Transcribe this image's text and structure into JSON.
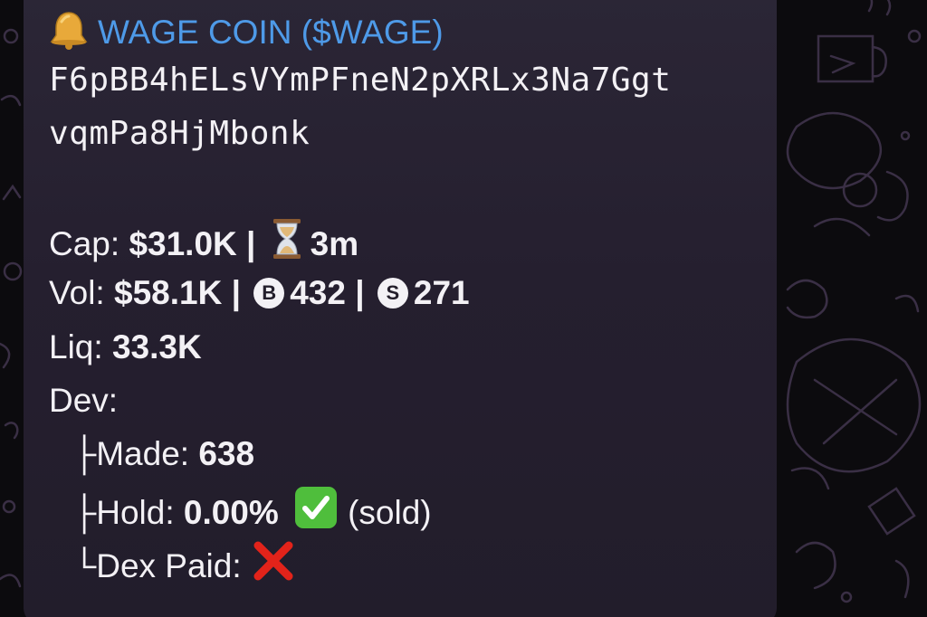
{
  "background": {
    "color": "#0c0b0e",
    "doodle_color": "#3a2f45",
    "bubble_color": "#2b2636"
  },
  "message": {
    "bell_icon": "bell-icon",
    "title": "WAGE COIN ($WAGE)",
    "title_color": "#4e9ae8",
    "address_line1": "F6pBB4hELsVYmPFneN2pXRLx3Na7Ggt",
    "address_line2": "vqmPa8HjMbonk",
    "cap_label": "Cap: ",
    "cap_value": "$31.0K |",
    "hourglass_icon": "hourglass-icon",
    "age_value": "3m",
    "vol_label": "Vol: ",
    "vol_value": "$58.1K |",
    "buy_badge": "B",
    "buys": "432 |",
    "sell_badge": "S",
    "sells": "271",
    "liq_label": "Liq: ",
    "liq_value": "33.3K",
    "dev_label": "Dev:",
    "made_prefix": "├",
    "made_label": "Made: ",
    "made_value": "638",
    "hold_prefix": "├",
    "hold_label": "Hold: ",
    "hold_value": "0.00%",
    "hold_check_icon": "check-mark-icon",
    "hold_note": "(sold)",
    "dex_prefix": "└",
    "dex_label": "Dex Paid: ",
    "dex_cross_icon": "cross-mark-icon"
  }
}
